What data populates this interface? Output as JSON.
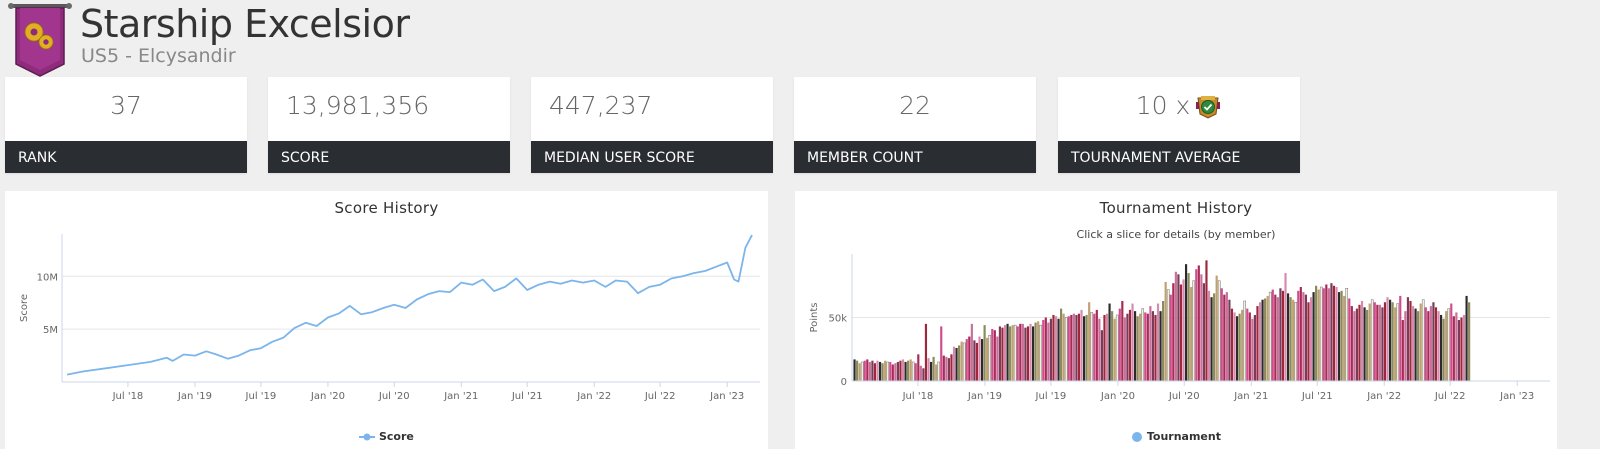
{
  "guild": {
    "name": "Starship Excelsior",
    "server": "US5 - Elcysandir"
  },
  "stats": {
    "rank": {
      "value": "37",
      "label": "RANK"
    },
    "score": {
      "value": "13,981,356",
      "label": "SCORE"
    },
    "median": {
      "value": "447,237",
      "label": "MEDIAN USER SCORE"
    },
    "members": {
      "value": "22",
      "label": "MEMBER COUNT"
    },
    "tournament": {
      "value": "10 x",
      "label": "TOURNAMENT AVERAGE",
      "icon": "trophy-icon"
    }
  },
  "colors": {
    "line": "#7cb5ec",
    "label_bg": "#2a2d31",
    "banner": "#8e2b7a",
    "bar_palette": [
      "#2b2b2b",
      "#8a8a5a",
      "#c0a070",
      "#f0f0e0",
      "#d04c8c",
      "#a82a55",
      "#c8709a",
      "#7a3a5a",
      "#a0263a",
      "#d68ab0"
    ]
  },
  "chart_data": [
    {
      "type": "line",
      "title": "Score History",
      "ylabel": "Score",
      "xlabel": "",
      "ylim": [
        0,
        14000000
      ],
      "yticks": [
        5000000,
        10000000
      ],
      "ytick_labels": [
        "5M",
        "10M"
      ],
      "xticks": [
        "2018-07-01",
        "2019-01-01",
        "2019-07-01",
        "2020-01-01",
        "2020-07-01",
        "2021-01-01",
        "2021-07-01",
        "2022-01-01",
        "2022-07-01",
        "2023-01-01"
      ],
      "xtick_labels": [
        "Jul '18",
        "Jan '19",
        "Jul '19",
        "Jan '20",
        "Jul '20",
        "Jan '21",
        "Jul '21",
        "Jan '22",
        "Jul '22",
        "Jan '23"
      ],
      "xlim": [
        "2018-01-01",
        "2023-04-01"
      ],
      "series": [
        {
          "name": "Score",
          "x": [
            "2018-01-15",
            "2018-03-01",
            "2018-05-01",
            "2018-07-01",
            "2018-09-01",
            "2018-10-15",
            "2018-11-01",
            "2018-12-01",
            "2019-01-01",
            "2019-02-01",
            "2019-03-01",
            "2019-04-01",
            "2019-05-01",
            "2019-06-01",
            "2019-07-01",
            "2019-08-01",
            "2019-09-01",
            "2019-10-01",
            "2019-11-01",
            "2019-12-01",
            "2020-01-01",
            "2020-02-01",
            "2020-03-01",
            "2020-04-01",
            "2020-05-01",
            "2020-06-01",
            "2020-07-01",
            "2020-08-01",
            "2020-09-01",
            "2020-10-01",
            "2020-11-01",
            "2020-12-01",
            "2021-01-01",
            "2021-02-01",
            "2021-03-01",
            "2021-04-01",
            "2021-05-01",
            "2021-06-01",
            "2021-07-01",
            "2021-08-01",
            "2021-09-01",
            "2021-10-01",
            "2021-11-01",
            "2021-12-01",
            "2022-01-01",
            "2022-02-01",
            "2022-03-01",
            "2022-04-01",
            "2022-05-01",
            "2022-06-01",
            "2022-07-01",
            "2022-08-01",
            "2022-09-01",
            "2022-10-01",
            "2022-11-01",
            "2022-12-01",
            "2023-01-01",
            "2023-01-20",
            "2023-02-01",
            "2023-02-20",
            "2023-03-10"
          ],
          "y": [
            700000,
            1000000,
            1300000,
            1600000,
            1900000,
            2300000,
            2000000,
            2600000,
            2500000,
            2900000,
            2600000,
            2200000,
            2500000,
            3000000,
            3200000,
            3800000,
            4200000,
            5100000,
            5600000,
            5300000,
            6100000,
            6500000,
            7200000,
            6400000,
            6600000,
            7000000,
            7300000,
            7000000,
            7800000,
            8300000,
            8600000,
            8500000,
            9400000,
            9200000,
            9700000,
            8600000,
            9000000,
            9800000,
            8700000,
            9200000,
            9500000,
            9300000,
            9600000,
            9400000,
            9600000,
            9000000,
            9600000,
            9500000,
            8400000,
            9000000,
            9200000,
            9800000,
            10000000,
            10300000,
            10500000,
            10900000,
            11300000,
            9700000,
            9500000,
            12700000,
            13900000
          ]
        }
      ],
      "legend": "bottom-center"
    },
    {
      "type": "bar",
      "title": "Tournament History",
      "subtitle": "Click a slice for details (by member)",
      "ylabel": "Points",
      "xlabel": "",
      "ylim": [
        0,
        100000
      ],
      "yticks": [
        0,
        50000
      ],
      "ytick_labels": [
        "0",
        "50k"
      ],
      "xticks": [
        "2018-07-01",
        "2019-01-01",
        "2019-07-01",
        "2020-01-01",
        "2020-07-01",
        "2021-01-01",
        "2021-07-01",
        "2022-01-01",
        "2022-07-01",
        "2023-01-01"
      ],
      "xtick_labels": [
        "Jul '18",
        "Jan '19",
        "Jul '19",
        "Jan '20",
        "Jul '20",
        "Jan '21",
        "Jul '21",
        "Jan '22",
        "Jul '22",
        "Jan '23"
      ],
      "xlim": [
        "2018-01-01",
        "2023-04-01"
      ],
      "series": [
        {
          "name": "Tournament",
          "start": "2018-01-08",
          "interval_days": 7,
          "values": [
            17000,
            16000,
            14000,
            15000,
            16000,
            17000,
            15000,
            16000,
            14000,
            16000,
            15000,
            14000,
            16000,
            15000,
            15000,
            13000,
            14000,
            15000,
            16000,
            17000,
            15000,
            16000,
            17000,
            15000,
            14000,
            21000,
            12000,
            10000,
            45000,
            18000,
            15000,
            19000,
            13000,
            15000,
            43000,
            20000,
            19000,
            18000,
            21000,
            27000,
            26000,
            28000,
            31000,
            30000,
            33000,
            35000,
            45000,
            32000,
            30000,
            35000,
            33000,
            44000,
            34000,
            36000,
            41000,
            40000,
            35000,
            43000,
            42000,
            44000,
            45000,
            43000,
            44000,
            44000,
            43000,
            45000,
            45000,
            42000,
            43000,
            45000,
            43000,
            46000,
            47000,
            44000,
            48000,
            50000,
            46000,
            49000,
            52000,
            51000,
            49000,
            57000,
            53000,
            50000,
            51000,
            52000,
            53000,
            52000,
            53000,
            56000,
            51000,
            52000,
            62000,
            54000,
            53000,
            56000,
            49000,
            40000,
            52000,
            53000,
            61000,
            55000,
            49000,
            52000,
            57000,
            63000,
            50000,
            53000,
            56000,
            61000,
            55000,
            51000,
            53000,
            57000,
            54000,
            53000,
            59000,
            55000,
            52000,
            61000,
            55000,
            63000,
            78000,
            72000,
            68000,
            77000,
            86000,
            84000,
            76000,
            80000,
            92000,
            85000,
            74000,
            79000,
            88000,
            91000,
            84000,
            77000,
            95000,
            71000,
            66000,
            69000,
            83000,
            79000,
            73000,
            68000,
            70000,
            64000,
            57000,
            54000,
            51000,
            53000,
            56000,
            63000,
            57000,
            54000,
            49000,
            52000,
            59000,
            62000,
            64000,
            65000,
            67000,
            70000,
            72000,
            68000,
            66000,
            73000,
            71000,
            85000,
            69000,
            66000,
            64000,
            62000,
            71000,
            74000,
            70000,
            68000,
            62000,
            66000,
            70000,
            75000,
            72000,
            74000,
            73000,
            76000,
            73000,
            77000,
            75000,
            74000,
            70000,
            71000,
            67000,
            73000,
            65000,
            59000,
            55000,
            57000,
            60000,
            63000,
            58000,
            56000,
            61000,
            64000,
            62000,
            60000,
            60000,
            58000,
            62000,
            66000,
            64000,
            62000,
            58000,
            61000,
            67000,
            48000,
            55000,
            66000,
            63000,
            59000,
            57000,
            55000,
            61000,
            64000,
            58000,
            55000,
            59000,
            62000,
            58000,
            55000,
            52000,
            49000,
            55000,
            57000,
            61000,
            51000,
            54000,
            48000,
            50000,
            52000,
            67000,
            62000
          ]
        }
      ],
      "legend": "bottom-center"
    }
  ]
}
